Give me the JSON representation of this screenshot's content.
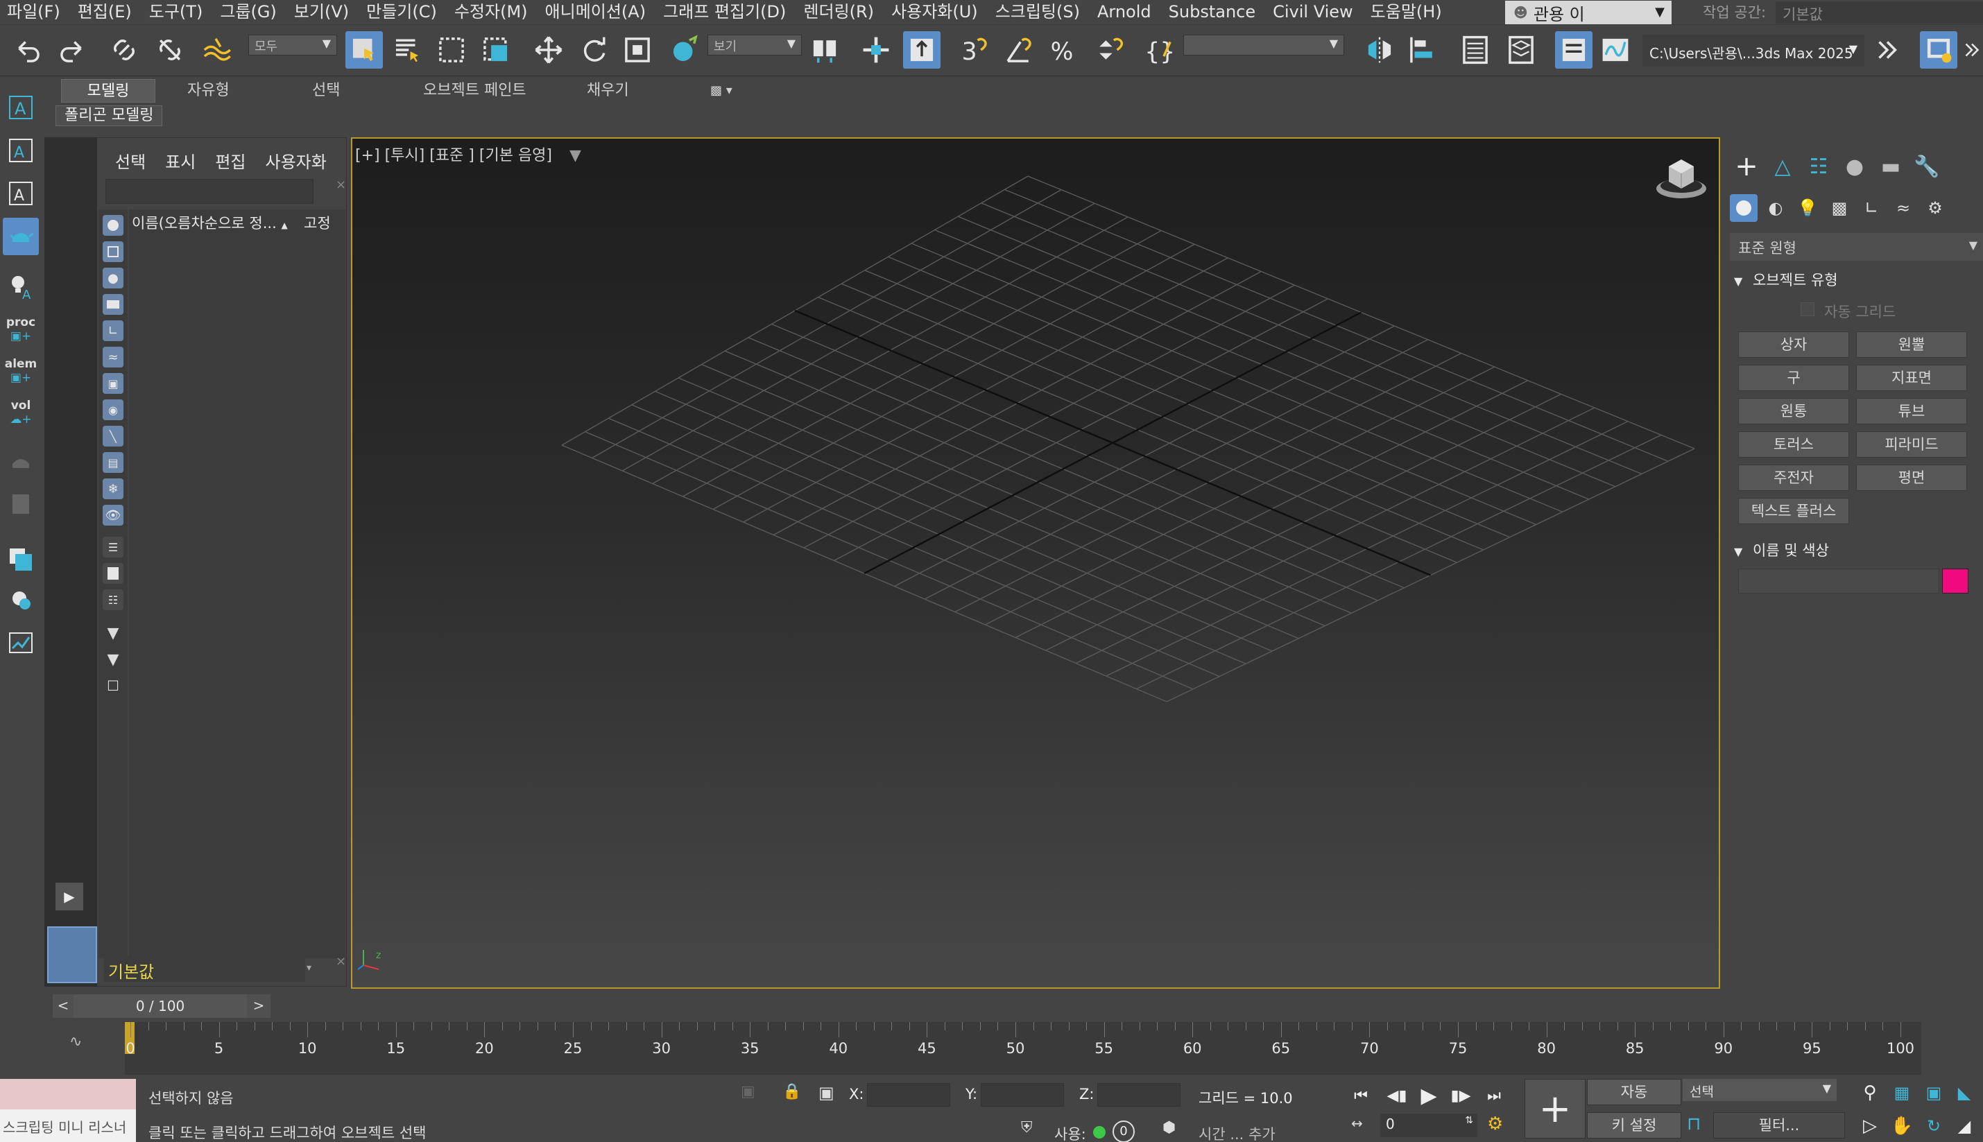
{
  "menubar": {
    "items": [
      "파일(F)",
      "편집(E)",
      "도구(T)",
      "그룹(G)",
      "보기(V)",
      "만들기(C)",
      "수정자(M)",
      "애니메이션(A)",
      "그래프 편집기(D)",
      "렌더링(R)",
      "사용자화(U)",
      "스크립팅(S)",
      "Arnold",
      "Substance",
      "Civil View",
      "도움말(H)"
    ],
    "user": "관용 이",
    "workspace_label": "작업 공간:",
    "workspace_value": "기본값"
  },
  "toolbar": {
    "selection_filter": "모두",
    "ref_coord": "보기",
    "named_selection": "",
    "project_path": "C:\\Users\\관용\\...3ds Max 2025"
  },
  "ribbon": {
    "tabs": [
      "모델링",
      "자유형",
      "선택",
      "오브젝트 페인트",
      "채우기"
    ],
    "active_tab": "모델링",
    "sub_label": "폴리곤 모델링"
  },
  "left_strip": {
    "labels": [
      "proc",
      "alem",
      "vol"
    ]
  },
  "explorer": {
    "menu": [
      "선택",
      "표시",
      "편집",
      "사용자화"
    ],
    "column_name": "이름(오름차순으로 정...",
    "column_pin": "고정",
    "layer": "기본값"
  },
  "viewport": {
    "label": "[+] [투시] [표준 ] [기본 음영]"
  },
  "command_panel": {
    "category": "표준 원형",
    "rollout_object_type": "오브젝트 유형",
    "auto_grid": "자동 그리드",
    "buttons": [
      "상자",
      "원뿔",
      "구",
      "지표면",
      "원통",
      "튜브",
      "토러스",
      "피라미드",
      "주전자",
      "평면",
      "텍스트 플러스"
    ],
    "rollout_name_color": "이름 및 색상",
    "object_color": "#f0097f"
  },
  "timeline": {
    "frame_display": "0 / 100",
    "prev": "<",
    "next": ">",
    "ticks": [
      "0",
      "5",
      "10",
      "15",
      "20",
      "25",
      "30",
      "35",
      "40",
      "45",
      "50",
      "55",
      "60",
      "65",
      "70",
      "75",
      "80",
      "85",
      "90",
      "95",
      "100"
    ]
  },
  "status": {
    "script_mini": "스크립팅 미니 리스너",
    "line1": "선택하지 않음",
    "line2": "클릭 또는 클릭하고 드래그하여 오브젝트 선택",
    "x_label": "X:",
    "y_label": "Y:",
    "z_label": "Z:",
    "grid": "그리드 = 10.0",
    "enabled": "사용:",
    "enabled_count": "0",
    "time_tag": "시간 ... 추가",
    "current_frame": "0",
    "auto_key": "자동",
    "set_key": "키 설정",
    "selection_set": "선택",
    "filters": "필터..."
  }
}
